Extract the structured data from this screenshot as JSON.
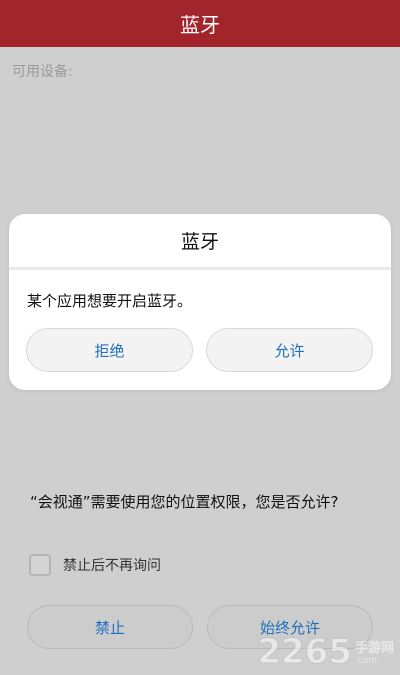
{
  "header": {
    "title": "蓝牙"
  },
  "section": {
    "label": "可用设备:"
  },
  "dialog": {
    "title": "蓝牙",
    "message": "某个应用想要开启蓝牙。",
    "deny_label": "拒绝",
    "allow_label": "允许"
  },
  "permission": {
    "message": "“会视通”需要使用您的位置权限，您是否允许?",
    "checkbox_label": "禁止后不再询问",
    "checkbox_checked": false,
    "deny_label": "禁止",
    "allow_label": "始终允许"
  },
  "watermark": {
    "number": "2265",
    "cn": "手游网",
    "domain": ".com"
  },
  "colors": {
    "header_bg": "#a1252b",
    "button_text": "#1f6fbf"
  }
}
